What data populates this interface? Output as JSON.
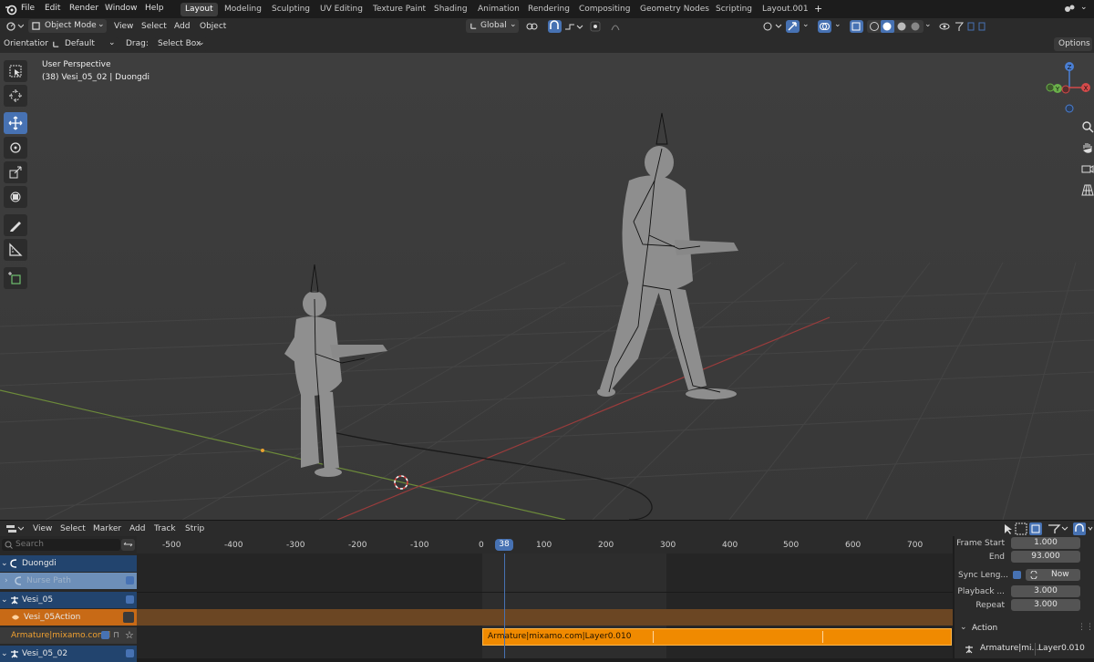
{
  "topbar": {
    "menus": [
      "File",
      "Edit",
      "Render",
      "Window",
      "Help"
    ],
    "workspaces": [
      "Layout",
      "Modeling",
      "Sculpting",
      "UV Editing",
      "Texture Paint",
      "Shading",
      "Animation",
      "Rendering",
      "Compositing",
      "Geometry Nodes",
      "Scripting",
      "Layout.001"
    ],
    "active_workspace": "Layout"
  },
  "header": {
    "mode": "Object Mode",
    "menus": [
      "View",
      "Select",
      "Add",
      "Object"
    ],
    "transform_orientation": "Global"
  },
  "tool_options": {
    "orientation_label": "Orientation:",
    "orientation_value": "Default",
    "drag_label": "Drag:",
    "drag_value": "Select Box",
    "options_label": "Options"
  },
  "viewport": {
    "perspective_label": "User Perspective",
    "object_label": "(38) Vesi_05_02 | Duongdi",
    "gizmo_axes": {
      "z": "Z",
      "x": "X",
      "y": "Y"
    }
  },
  "timeline": {
    "menus": [
      "View",
      "Select",
      "Marker",
      "Add",
      "Track",
      "Strip"
    ],
    "search_placeholder": "Search",
    "ruler_ticks": [
      "-500",
      "-400",
      "-300",
      "-200",
      "-100",
      "0",
      "100",
      "200",
      "300",
      "400",
      "500",
      "600",
      "700"
    ],
    "current_frame": "38",
    "tracks": [
      {
        "name": "Duongdi",
        "kind": "object"
      },
      {
        "name": "Nurse Path",
        "kind": "path"
      },
      {
        "name": "Vesi_05",
        "kind": "object"
      },
      {
        "name": "Vesi_05Action",
        "kind": "action"
      },
      {
        "name": "Armature|mixamo.com|l",
        "kind": "strip-track"
      },
      {
        "name": "Vesi_05_02",
        "kind": "object"
      }
    ],
    "strip_label": "Armature|mixamo.com|Layer0.010"
  },
  "properties": {
    "frame_start_label": "Frame Start",
    "frame_start_value": "1.000",
    "end_label": "End",
    "end_value": "93.000",
    "sync_label": "Sync Leng...",
    "sync_now": "Now",
    "playback_label": "Playback ...",
    "playback_value": "3.000",
    "repeat_label": "Repeat",
    "repeat_value": "3.000",
    "action_section": "Action",
    "action_value": "Armature|mi...",
    "action_layer": "Layer0.010"
  },
  "colors": {
    "accent": "#4772b3",
    "strip": "#f08a00",
    "action_track": "#c86a16"
  }
}
